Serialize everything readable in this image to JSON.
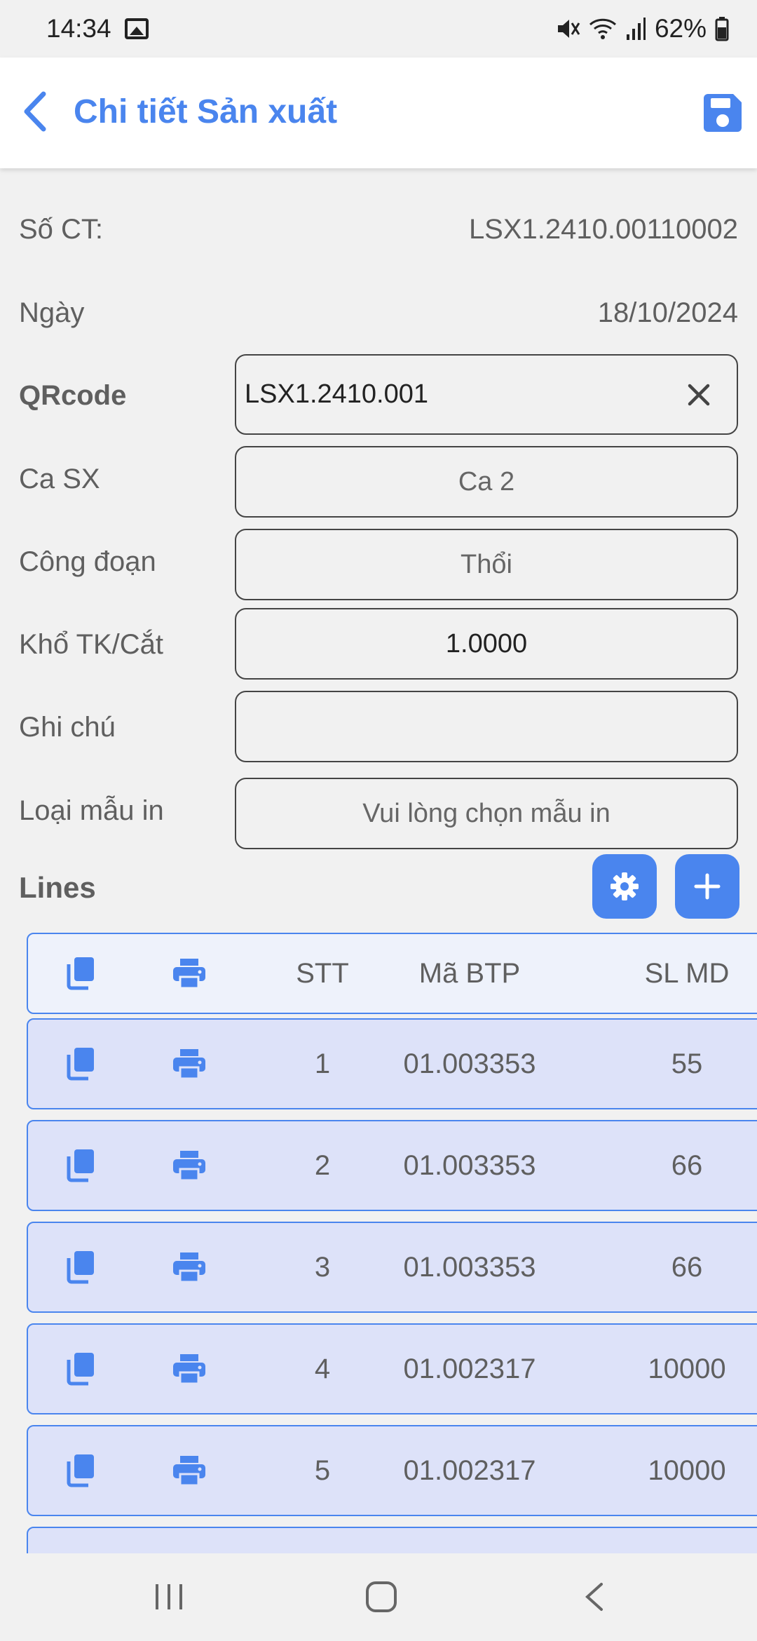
{
  "status_bar": {
    "time": "14:34",
    "battery": "62%"
  },
  "header": {
    "title": "Chi tiết Sản xuất"
  },
  "info": {
    "so_ct_label": "Số CT:",
    "so_ct_value": "LSX1.2410.00110002",
    "ngay_label": "Ngày",
    "ngay_value": "18/10/2024"
  },
  "form": {
    "qrcode_label": "QRcode",
    "qrcode_value": "LSX1.2410.001",
    "ca_sx_label": "Ca SX",
    "ca_sx_value": "Ca 2",
    "cong_doan_label": "Công đoạn",
    "cong_doan_value": "Thổi",
    "kho_label": "Khổ TK/Cắt",
    "kho_value": "1.0000",
    "ghi_chu_label": "Ghi chú",
    "ghi_chu_value": "",
    "loai_mau_in_label": "Loại mẫu in",
    "loai_mau_in_placeholder": "Vui lòng chọn mẫu in"
  },
  "lines": {
    "label": "Lines",
    "columns": {
      "stt": "STT",
      "ma_btp": "Mã BTP",
      "sl_md": "SL MD"
    },
    "rows": [
      {
        "stt": "1",
        "ma_btp": "01.003353",
        "sl_md": "55"
      },
      {
        "stt": "2",
        "ma_btp": "01.003353",
        "sl_md": "66"
      },
      {
        "stt": "3",
        "ma_btp": "01.003353",
        "sl_md": "66"
      },
      {
        "stt": "4",
        "ma_btp": "01.002317",
        "sl_md": "10000"
      },
      {
        "stt": "5",
        "ma_btp": "01.002317",
        "sl_md": "10000"
      }
    ]
  },
  "icons": {
    "back": "chevron-left-icon",
    "save": "floppy-disk-icon",
    "clear": "close-icon",
    "settings": "gear-icon",
    "add": "plus-icon",
    "copy": "copy-icon",
    "print": "printer-icon"
  },
  "colors": {
    "accent": "#4a85ee",
    "row_bg": "#dde2f9",
    "header_row_bg": "#eef2fb",
    "background": "#f1f1f1"
  }
}
